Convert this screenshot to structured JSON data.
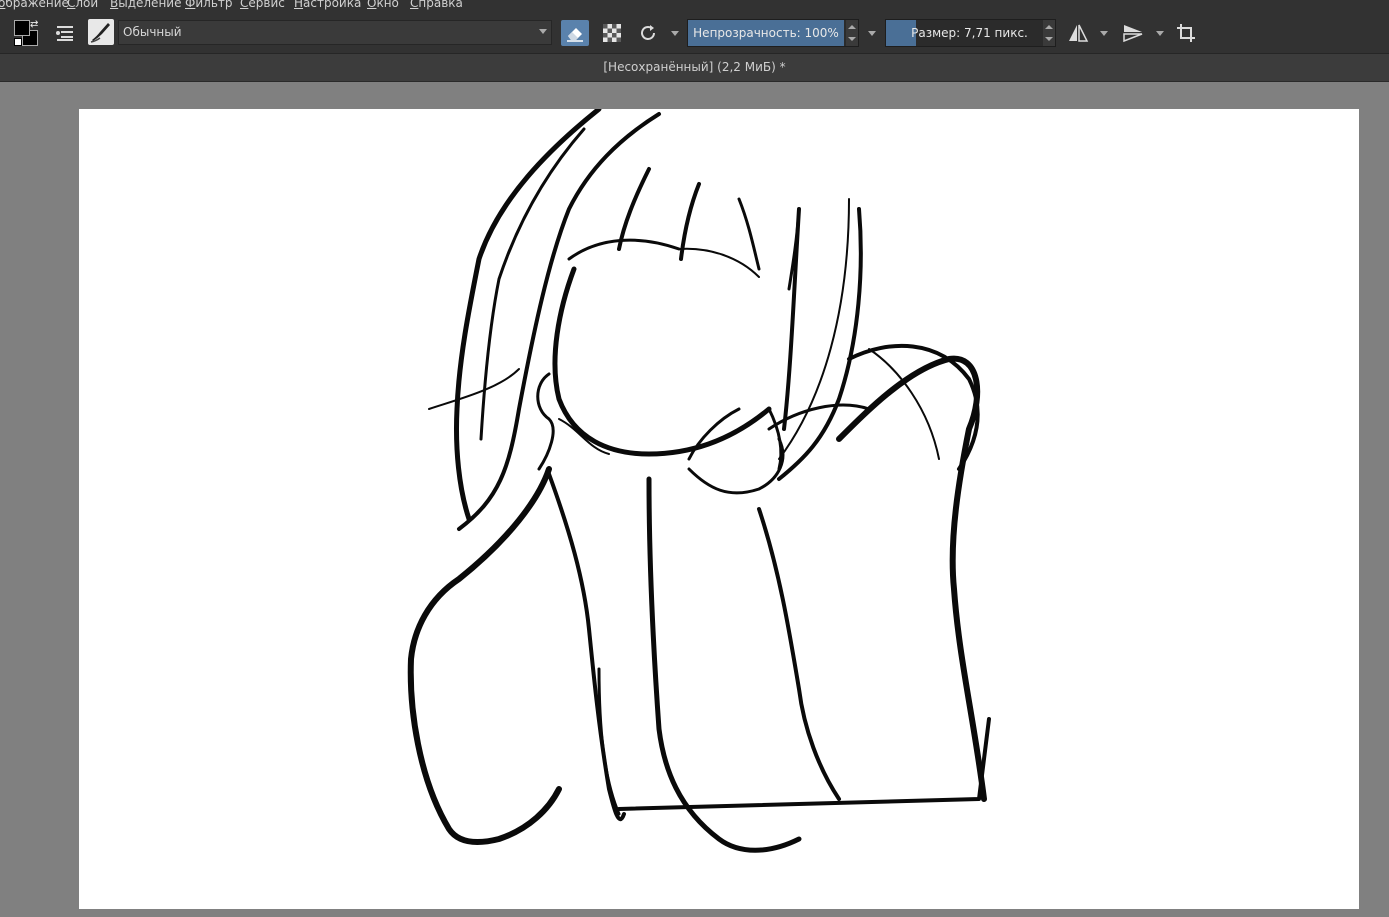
{
  "menu": {
    "items": [
      "ображение",
      "Слой",
      "Выделение",
      "Фильтр",
      "Сервис",
      "Настройка",
      "Окно",
      "Справка"
    ]
  },
  "toolbar": {
    "blending_mode": "Обычный",
    "opacity_label": "Непрозрачность: 100%",
    "opacity_value": 1.0,
    "size_label": "Размер: 7,71 пикс.",
    "eraser_active": true,
    "colors": {
      "accent": "#4a6f96",
      "eraser_bg": "#5a82ac",
      "foreground": "#000000",
      "background": "#000000"
    },
    "icons": [
      "fg-bg-color-icon",
      "brush-settings-icon",
      "brush-preset-icon",
      "eraser-icon",
      "preserve-alpha-icon",
      "reload-preset-icon",
      "mirror-horizontal-icon",
      "mirror-vertical-icon",
      "wrap-around-icon"
    ]
  },
  "document": {
    "title": "[Несохранённый]  (2,2 МиБ) *"
  }
}
